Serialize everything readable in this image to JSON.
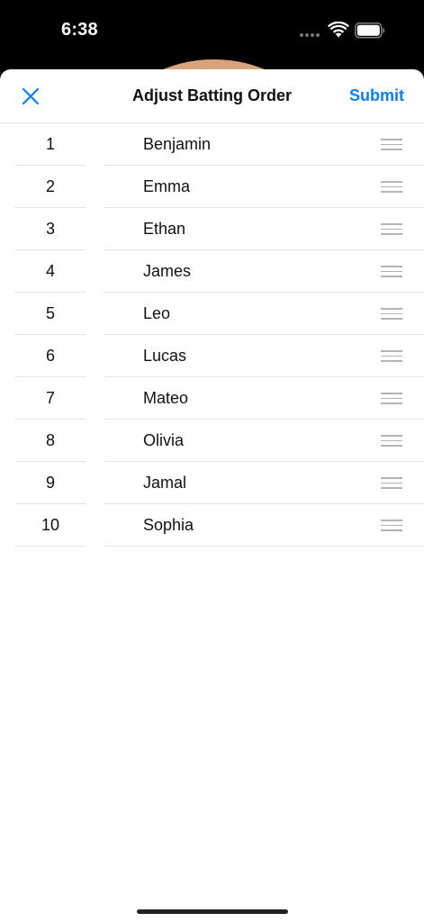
{
  "status_bar": {
    "time": "6:38"
  },
  "nav": {
    "title": "Adjust Batting Order",
    "submit_label": "Submit",
    "close_icon": "close-icon"
  },
  "colors": {
    "accent": "#0a7ef5",
    "peek": "#d9a47b"
  },
  "batting_order": [
    {
      "number": "1",
      "name": "Benjamin"
    },
    {
      "number": "2",
      "name": "Emma"
    },
    {
      "number": "3",
      "name": "Ethan"
    },
    {
      "number": "4",
      "name": "James"
    },
    {
      "number": "5",
      "name": "Leo"
    },
    {
      "number": "6",
      "name": "Lucas"
    },
    {
      "number": "7",
      "name": "Mateo"
    },
    {
      "number": "8",
      "name": "Olivia"
    },
    {
      "number": "9",
      "name": "Jamal"
    },
    {
      "number": "10",
      "name": "Sophia"
    }
  ]
}
